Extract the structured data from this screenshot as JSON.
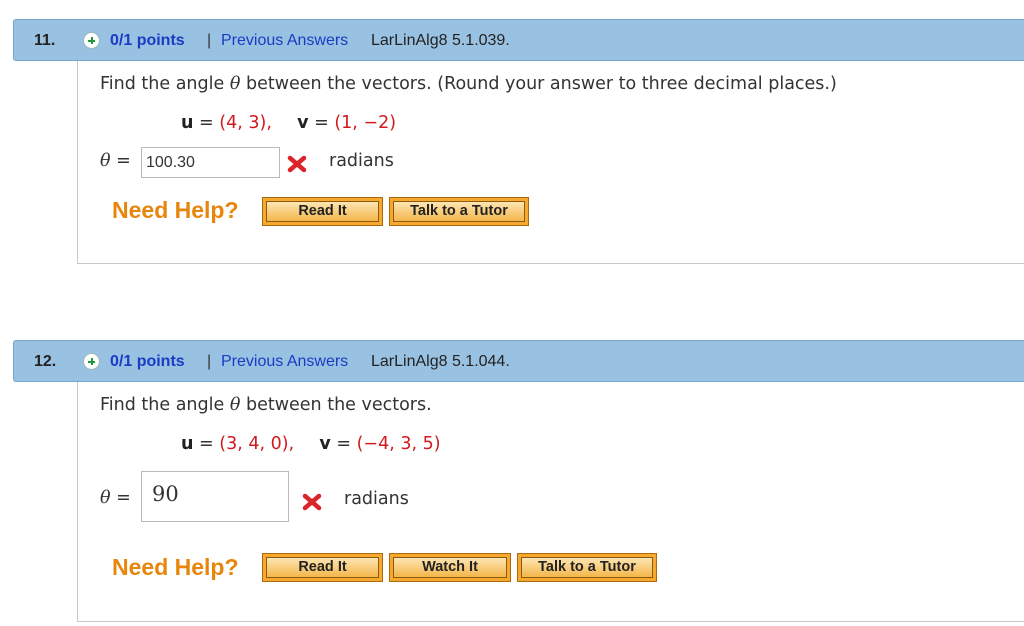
{
  "questions": [
    {
      "number": "11.",
      "points": "0/1 points",
      "separator": "|",
      "previous_answers_link": "Previous Answers",
      "problem_code": "LarLinAlg8 5.1.039.",
      "prompt_start": "Find the angle",
      "prompt_symbol": "θ",
      "prompt_end": "between the vectors. (Round your answer to three decimal places.)",
      "u_label": "u",
      "u_value": "(4, 3),",
      "v_label": "v",
      "v_value": "(1, −2)",
      "answer_symbol": "θ",
      "equals": "=",
      "answer_value": "100.30",
      "answer_status": "incorrect",
      "unit": "radians",
      "need_help": "Need Help?",
      "buttons": [
        "Read It",
        "Talk to a Tutor"
      ]
    },
    {
      "number": "12.",
      "points": "0/1 points",
      "separator": "|",
      "previous_answers_link": "Previous Answers",
      "problem_code": "LarLinAlg8 5.1.044.",
      "prompt_start": "Find the angle",
      "prompt_symbol": "θ",
      "prompt_end": "between the vectors.",
      "u_label": "u",
      "u_value": "(3, 4, 0),",
      "v_label": "v",
      "v_value": "(−4, 3, 5)",
      "answer_symbol": "θ",
      "equals": "=",
      "answer_value": "90",
      "answer_status": "incorrect",
      "unit": "radians",
      "need_help": "Need Help?",
      "buttons": [
        "Read It",
        "Watch It",
        "Talk to a Tutor"
      ]
    }
  ],
  "colors": {
    "header_bg": "#99c1e2",
    "link_blue": "#1a3cc4",
    "value_red": "#d2191c",
    "help_orange": "#e8860c",
    "button_orange": "#f7a82d"
  },
  "icons": {
    "status_icon": "plus-circle-icon",
    "incorrect_icon": "red-x-icon"
  }
}
